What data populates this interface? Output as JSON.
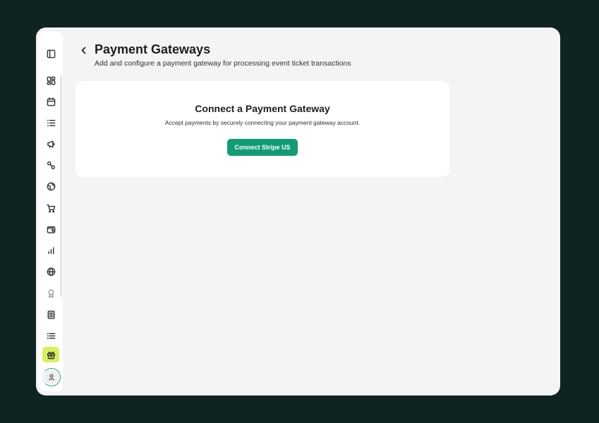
{
  "header": {
    "title": "Payment Gateways",
    "subtitle": "Add and configure a payment gateway for processing event ticket transactions"
  },
  "card": {
    "title": "Connect a Payment Gateway",
    "description": "Accept payments by securely connecting your payment gateway account.",
    "button_label": "Connect Stripe US"
  },
  "sidebar": {
    "items": [
      {
        "icon": "sidebar-toggle-icon"
      },
      {
        "icon": "dashboard-icon"
      },
      {
        "icon": "calendar-icon"
      },
      {
        "icon": "list-icon"
      },
      {
        "icon": "megaphone-icon"
      },
      {
        "icon": "integrations-icon"
      },
      {
        "icon": "globe-web-icon"
      },
      {
        "icon": "cart-icon"
      },
      {
        "icon": "wallet-icon"
      },
      {
        "icon": "bar-chart-icon"
      },
      {
        "icon": "globe-icon"
      },
      {
        "icon": "award-icon"
      },
      {
        "icon": "receipt-icon"
      },
      {
        "icon": "menu-list-icon"
      },
      {
        "icon": "gift-icon"
      },
      {
        "icon": "user-icon"
      }
    ]
  },
  "colors": {
    "background": "#0e2322",
    "window": "#f4f4f4",
    "accent": "#129c76",
    "gift_highlight": "#d8f15b"
  }
}
